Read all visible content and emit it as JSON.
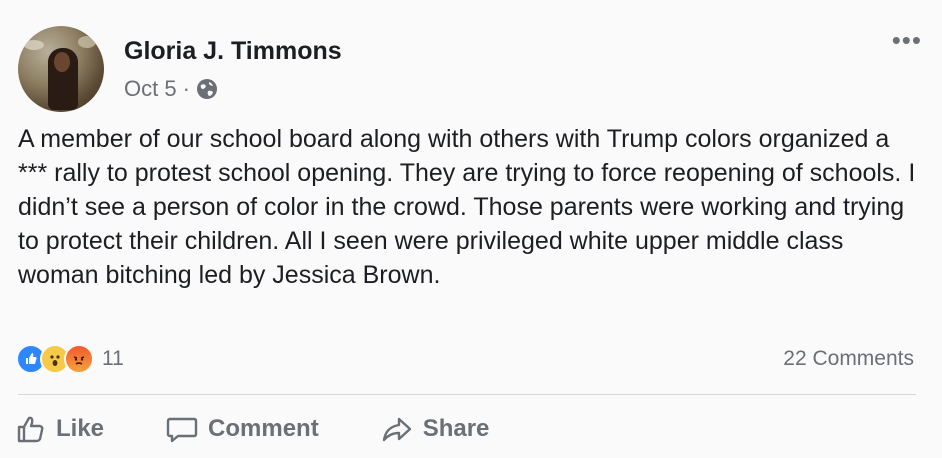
{
  "post": {
    "author": "Gloria J. Timmons",
    "date": "Oct 5",
    "separator": "·",
    "audience_icon": "globe-icon",
    "text": "A member of our school board along with others with Trump colors organized a *** rally to protest school opening. They are trying to force reopening of schools. I didn’t see a person of color in the crowd. Those parents were working and trying to protect their children. All I seen were privileged white upper middle class woman bitching led by Jessica Brown.",
    "more_icon": "•••"
  },
  "engagement": {
    "reaction_icons": [
      "like-icon",
      "wow-icon",
      "angry-icon"
    ],
    "reaction_count": "11",
    "comments": "22 Comments"
  },
  "actions": {
    "like": "Like",
    "comment": "Comment",
    "share": "Share"
  },
  "colors": {
    "like_blue": "#2d88ff",
    "muted_text": "#6b6f76"
  }
}
